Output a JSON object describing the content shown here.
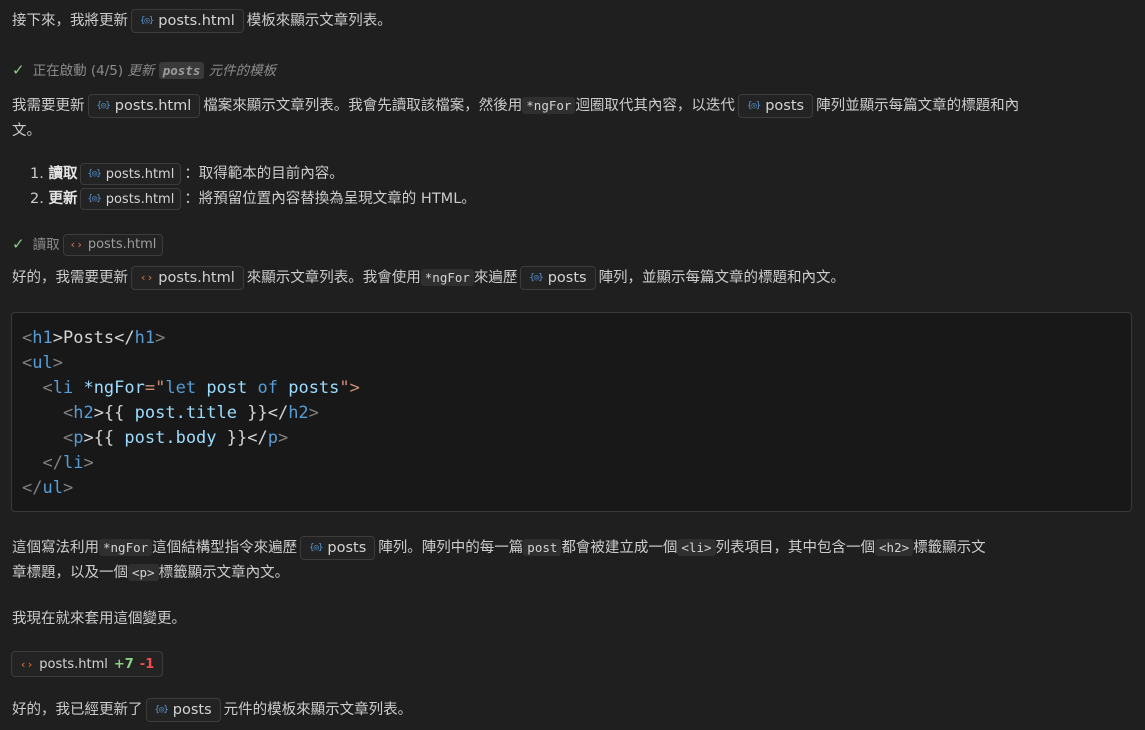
{
  "intro": {
    "text_before": "接下來，我將更新",
    "file": "posts.html",
    "text_after": "模板來顯示文章列表。"
  },
  "status1": {
    "label": "正在啟動 (4/5)",
    "em_before": "更新",
    "code": "posts",
    "em_after": "元件的模板"
  },
  "para1": {
    "t1": "我需要更新",
    "file": "posts.html",
    "t2": "檔案來顯示文章列表。我會先讀取該檔案，然後用",
    "code": "*ngFor",
    "t3": "迴圈取代其內容，以迭代",
    "var": "posts",
    "t4": "陣列並顯示每篇文章的標題和內",
    "t5": "文。"
  },
  "steps": [
    {
      "num": "1.",
      "bold": "讀取",
      "file": "posts.html",
      "desc": "：取得範本的目前內容。"
    },
    {
      "num": "2.",
      "bold": "更新",
      "file": "posts.html",
      "desc": "：將預留位置內容替換為呈現文章的 HTML。"
    }
  ],
  "status2": {
    "label": "讀取",
    "file": "posts.html"
  },
  "para2": {
    "t1": "好的，我需要更新",
    "file": "posts.html",
    "t2": "來顯示文章列表。我會使用",
    "code": "*ngFor",
    "t3": "來遍歷",
    "var": "posts",
    "t4": "陣列，並顯示每篇文章的標題和內文。"
  },
  "code_lines": [
    {
      "a": "<",
      "b": "h1",
      "c": ">Posts</",
      "d": "h1",
      "e": ">"
    },
    {
      "a": "<",
      "b": "ul",
      "c": ">"
    },
    {
      "indent": "  ",
      "a": "<",
      "b": "li",
      "attr": " *ngFor",
      "eq": "=\"",
      "kw1": "let",
      "v1": " post ",
      "kw2": "of",
      "v2": " posts",
      "end": "\">"
    },
    {
      "indent": "    ",
      "a": "<",
      "b": "h2",
      "c": ">{{ ",
      "v": "post.title",
      "c2": " }}</",
      "d": "h2",
      "e": ">"
    },
    {
      "indent": "    ",
      "a": "<",
      "b": "p",
      "c": ">{{ ",
      "v": "post.body",
      "c2": " }}</",
      "d": "p",
      "e": ">"
    },
    {
      "indent": "  ",
      "a": "</",
      "b": "li",
      "c": ">"
    },
    {
      "a": "</",
      "b": "ul",
      "c": ">"
    }
  ],
  "para3": {
    "t1": "這個寫法利用",
    "code1": "*ngFor",
    "t2": "這個結構型指令來遍歷",
    "var": "posts",
    "t3": "陣列。陣列中的每一篇",
    "code2": "post",
    "t4": "都會被建立成一個",
    "code3": "<li>",
    "t5": "列表項目，其中包含一個",
    "code4": "<h2>",
    "t6": "標籤顯示文",
    "t7": "章標題，以及一個",
    "code5": "<p>",
    "t8": "標籤顯示文章內文。"
  },
  "para4": "我現在就來套用這個變更。",
  "diff": {
    "file": "posts.html",
    "added": "+7",
    "removed": "-1"
  },
  "para5": {
    "t1": "好的，我已經更新了",
    "var": "posts",
    "t2": "元件的模板來顯示文章列表。"
  }
}
